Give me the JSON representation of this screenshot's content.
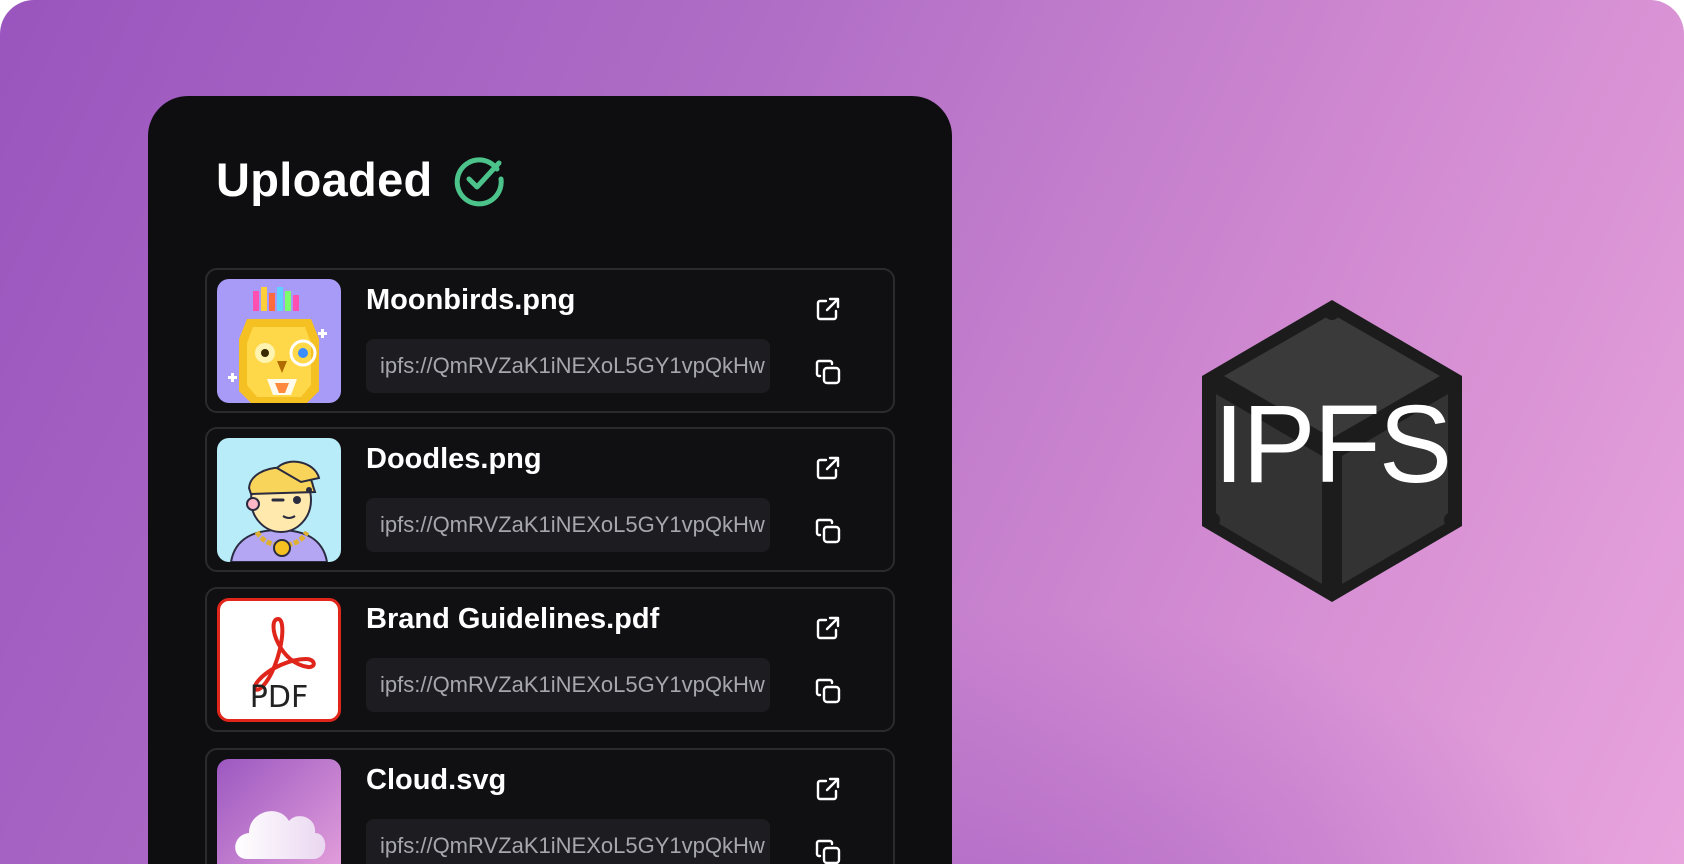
{
  "panel": {
    "title": "Uploaded",
    "title_icon": "check-circle-icon",
    "accent_color": "#4cc38a"
  },
  "files": [
    {
      "name": "Moonbirds.png",
      "cid": "ipfs://QmRVZaK1iNEXoL5GY1vpQkHw",
      "thumbnail": "moonbird-owl-image",
      "open_icon": "external-link-icon",
      "copy_icon": "copy-icon"
    },
    {
      "name": "Doodles.png",
      "cid": "ipfs://QmRVZaK1iNEXoL5GY1vpQkHw",
      "thumbnail": "doodle-character-image",
      "open_icon": "external-link-icon",
      "copy_icon": "copy-icon"
    },
    {
      "name": "Brand Guidelines.pdf",
      "cid": "ipfs://QmRVZaK1iNEXoL5GY1vpQkHw",
      "thumbnail": "pdf-file-image",
      "thumbnail_label": "PDF",
      "open_icon": "external-link-icon",
      "copy_icon": "copy-icon"
    },
    {
      "name": "Cloud.svg",
      "cid": "ipfs://QmRVZaK1iNEXoL5GY1vpQkHw",
      "thumbnail": "cloud-image",
      "open_icon": "external-link-icon",
      "copy_icon": "copy-icon"
    }
  ],
  "brand": {
    "logo_text": "IPFS",
    "logo_icon": "ipfs-cube-icon"
  },
  "colors": {
    "background_start": "#9a55be",
    "background_end": "#e8a4dd",
    "panel": "#0e0e10",
    "card_border": "#2b2b2f",
    "cid_field": "#1d1d21"
  }
}
